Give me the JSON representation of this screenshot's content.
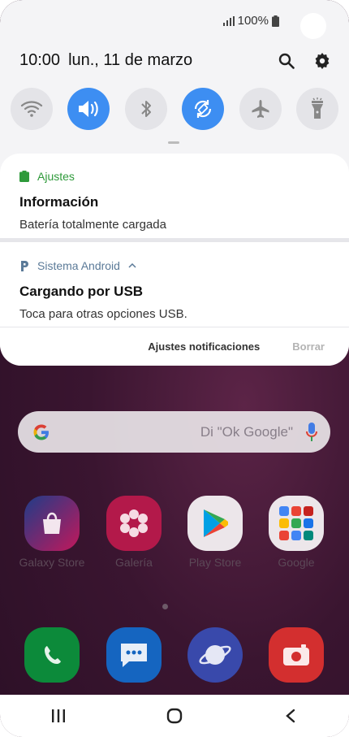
{
  "status": {
    "signal_icon": "signal-icon",
    "battery_percent": "100%",
    "battery_icon": "battery-icon"
  },
  "header": {
    "time": "10:00",
    "date": "lun., 11 de marzo",
    "search_icon": "search-icon",
    "settings_icon": "gear-icon"
  },
  "quick_toggles": [
    {
      "name": "wifi",
      "icon": "wifi-icon",
      "on": false
    },
    {
      "name": "sound",
      "icon": "volume-icon",
      "on": true
    },
    {
      "name": "bluetooth",
      "icon": "bluetooth-icon",
      "on": false
    },
    {
      "name": "auto-rotate",
      "icon": "rotate-icon",
      "on": true
    },
    {
      "name": "airplane",
      "icon": "airplane-icon",
      "on": false
    },
    {
      "name": "flashlight",
      "icon": "flashlight-icon",
      "on": false
    }
  ],
  "notifications": [
    {
      "app": "Ajustes",
      "app_color": "#2e9a3a",
      "title": "Información",
      "body": "Batería totalmente cargada"
    },
    {
      "app": "Sistema Android",
      "app_color": "#5b7a98",
      "title": "Cargando por USB",
      "body": "Toca para otras opciones USB."
    }
  ],
  "notification_actions": {
    "settings": "Ajustes notificaciones",
    "clear": "Borrar"
  },
  "home": {
    "search_hint": "Di \"Ok Google\"",
    "apps": [
      {
        "label": "Galaxy Store"
      },
      {
        "label": "Galería"
      },
      {
        "label": "Play Store"
      },
      {
        "label": "Google"
      }
    ]
  },
  "colors": {
    "accent": "#3d8ef2",
    "shade_bg": "#f4f4f6"
  }
}
